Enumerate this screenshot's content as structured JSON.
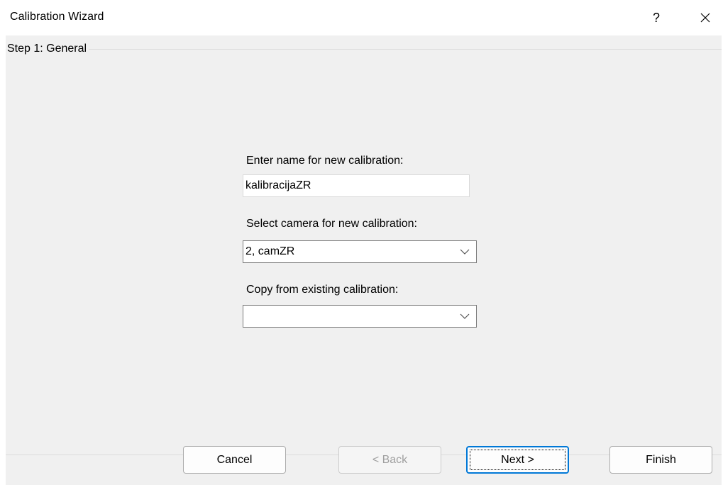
{
  "window": {
    "title": "Calibration Wizard",
    "help_label": "?",
    "close_icon": "close-icon"
  },
  "step": {
    "legend": "Step 1: General"
  },
  "form": {
    "name_label": "Enter name for new calibration:",
    "name_value": "kalibracijaZR",
    "camera_label": "Select camera for new calibration:",
    "camera_value": "2, camZR",
    "copy_label": "Copy from existing calibration:",
    "copy_value": ""
  },
  "buttons": {
    "cancel": "Cancel",
    "back": "< Back",
    "next": "Next >",
    "finish": "Finish"
  }
}
